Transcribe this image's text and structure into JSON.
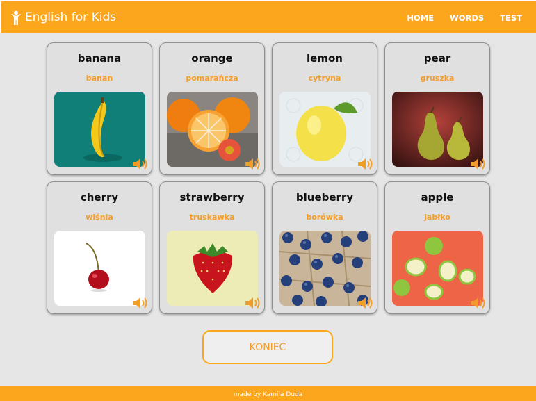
{
  "header": {
    "title": "English for Kids",
    "logo_icon": "kid-figure-icon",
    "nav": [
      "HOME",
      "WORDS",
      "TEST"
    ]
  },
  "cards": [
    {
      "word": "banana",
      "translation": "banan",
      "image": "banana-photo"
    },
    {
      "word": "orange",
      "translation": "pomarańcza",
      "image": "orange-photo"
    },
    {
      "word": "lemon",
      "translation": "cytryna",
      "image": "lemon-photo"
    },
    {
      "word": "pear",
      "translation": "gruszka",
      "image": "pear-photo"
    },
    {
      "word": "cherry",
      "translation": "wiśnia",
      "image": "cherry-photo"
    },
    {
      "word": "strawberry",
      "translation": "truskawka",
      "image": "strawberry-photo"
    },
    {
      "word": "blueberry",
      "translation": "borówka",
      "image": "blueberry-photo"
    },
    {
      "word": "apple",
      "translation": "jabłko",
      "image": "apple-photo"
    }
  ],
  "finish_button": "KONIEC",
  "footer": {
    "text": "made by  Kamila Duda"
  },
  "colors": {
    "accent": "#fba61d",
    "translation": "#f39c2a",
    "background": "#e6e6e6"
  }
}
